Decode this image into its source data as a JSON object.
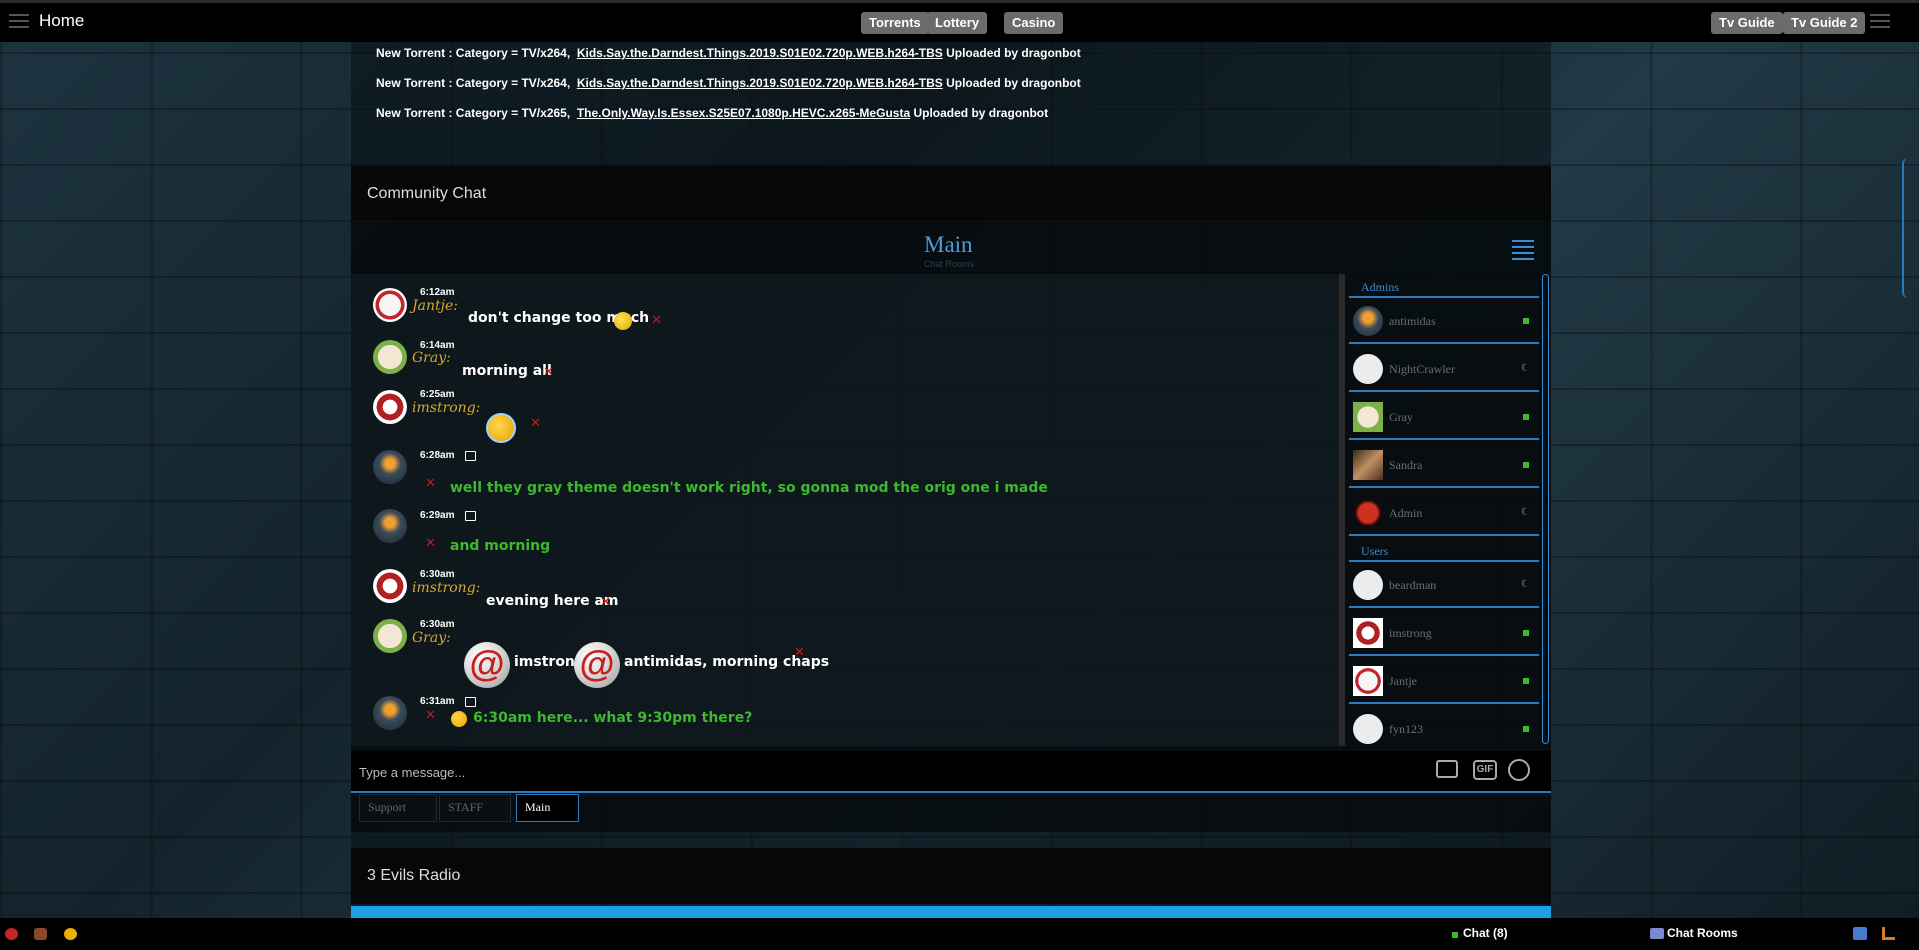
{
  "nav": {
    "home": "Home",
    "buttons": [
      "Torrents",
      "Lottery",
      "Casino"
    ],
    "right_buttons": [
      "Tv Guide",
      "Tv Guide 2"
    ]
  },
  "torrents": [
    {
      "prefix": "New Torrent : Category = TV/x264,",
      "link": "Kids.Say.the.Darndest.Things.2019.S01E02.720p.WEB.h264-TBS",
      "suffix": "Uploaded by dragonbot"
    },
    {
      "prefix": "New Torrent : Category = TV/x264,",
      "link": "Kids.Say.the.Darndest.Things.2019.S01E02.720p.WEB.h264-TBS",
      "suffix": "Uploaded by dragonbot"
    },
    {
      "prefix": "New Torrent : Category = TV/x265,",
      "link": "The.Only.Way.Is.Essex.S25E07.1080p.HEVC.x265-MeGusta",
      "suffix": "Uploaded by dragonbot"
    }
  ],
  "chat": {
    "title": "Community Chat",
    "room": "Main",
    "room_sub": "Chat Rooms",
    "messages": [
      {
        "time": "6:12am",
        "user": "Jantje:",
        "text": "don't change too much"
      },
      {
        "time": "6:14am",
        "user": "Gray:",
        "text": "morning all"
      },
      {
        "time": "6:25am",
        "user": "imstrong:",
        "text": ""
      },
      {
        "time": "6:28am",
        "user": "",
        "text": "well they gray theme doesn't work right, so gonna mod the orig one i made"
      },
      {
        "time": "6:29am",
        "user": "",
        "text": "and morning"
      },
      {
        "time": "6:30am",
        "user": "imstrong:",
        "text": "evening here am"
      },
      {
        "time": "6:30am",
        "user": "Gray:",
        "text": "imstrong",
        "text2": "antimidas, morning chaps"
      },
      {
        "time": "6:31am",
        "user": "",
        "text": "6:30am here... what 9:30pm there?"
      }
    ],
    "placeholder": "Type a message...",
    "tabs": [
      "Support",
      "STAFF",
      "Main"
    ]
  },
  "sidebar": {
    "admins_label": "Admins",
    "users_label": "Users",
    "admins": [
      {
        "name": "antimidas",
        "status": "online"
      },
      {
        "name": "NightCrawler",
        "status": "away"
      },
      {
        "name": "Gray",
        "status": "online"
      },
      {
        "name": "Sandra",
        "status": "online"
      },
      {
        "name": "Admin",
        "status": "away"
      }
    ],
    "users": [
      {
        "name": "beardman",
        "status": "away"
      },
      {
        "name": "imstrong",
        "status": "online"
      },
      {
        "name": "Jantje",
        "status": "online"
      },
      {
        "name": "fyn123",
        "status": "online"
      }
    ]
  },
  "radio": {
    "title": "3 Evils Radio"
  },
  "bottom": {
    "chat": "Chat (8)",
    "rooms": "Chat Rooms"
  },
  "colors": {
    "accent": "#2a79b8",
    "user_name": "#d4a830",
    "green_text": "#3cba2c",
    "delete": "#c21b1b"
  }
}
